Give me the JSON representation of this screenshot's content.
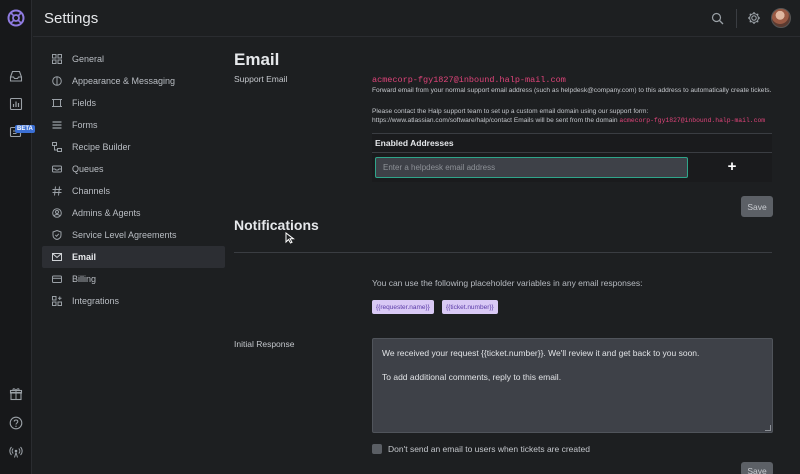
{
  "topbar": {
    "title": "Settings"
  },
  "nav": {
    "items": [
      {
        "label": "General",
        "icon": "grid-icon"
      },
      {
        "label": "Appearance & Messaging",
        "icon": "palette-icon"
      },
      {
        "label": "Fields",
        "icon": "fields-icon"
      },
      {
        "label": "Forms",
        "icon": "forms-icon"
      },
      {
        "label": "Recipe Builder",
        "icon": "recipe-icon"
      },
      {
        "label": "Queues",
        "icon": "queue-icon"
      },
      {
        "label": "Channels",
        "icon": "hash-icon"
      },
      {
        "label": "Admins & Agents",
        "icon": "user-icon"
      },
      {
        "label": "Service Level Agreements",
        "icon": "shield-icon"
      },
      {
        "label": "Email",
        "icon": "mail-icon",
        "active": true
      },
      {
        "label": "Billing",
        "icon": "billing-icon"
      },
      {
        "label": "Integrations",
        "icon": "integrations-icon"
      }
    ]
  },
  "rail": {
    "beta_label": "BETA"
  },
  "email": {
    "heading": "Email",
    "support_label": "Support Email",
    "support_address": "acmecorp-fgy1827@inbound.halp-mail.com",
    "forward_note": "Forward email from your normal support email address (such as helpdesk@company.com) to this address to automatically create tickets.",
    "contact_note": "Please contact the Halp support team to set up a custom email domain using our support form:",
    "contact_url_text": "https://www.atlassian.com/software/halp/contact Emails will be sent from the domain",
    "domain": "acmecorp-fgy1827@inbound.halp-mail.com",
    "enabled_header": "Enabled Addresses",
    "input_placeholder": "Enter a helpdesk email address",
    "add_label": "+",
    "save_label": "Save"
  },
  "notifications": {
    "heading": "Notifications",
    "placeholder_note": "You can use the following placeholder variables in any email responses:",
    "chips": [
      "{{requester.name}}",
      "{{ticket.number}}"
    ],
    "initial_response_label": "Initial Response",
    "initial_response_line1": "We received your request {{ticket.number}}. We'll review it and get back to you soon.",
    "initial_response_line2": "To add additional comments, reply to this email.",
    "dont_send_label": "Don't send an email to users when tickets are created",
    "save_label": "Save"
  }
}
